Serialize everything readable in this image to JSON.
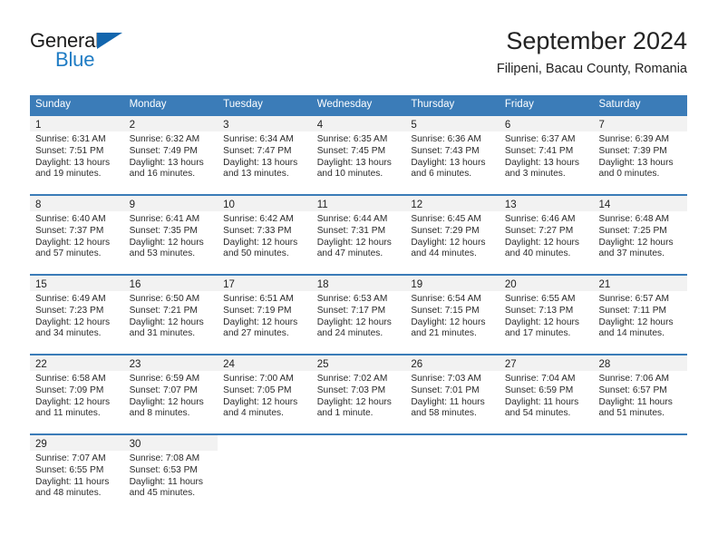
{
  "brand": {
    "name_part1": "General",
    "name_part2": "Blue",
    "color_dark": "#1b1b1b",
    "color_blue": "#1f7cc4"
  },
  "header": {
    "title": "September 2024",
    "subtitle": "Filipeni, Bacau County, Romania"
  },
  "theme": {
    "header_bar": "#3b7cb8",
    "day_band": "#f2f2f2",
    "text": "#222222"
  },
  "weekdays": [
    "Sunday",
    "Monday",
    "Tuesday",
    "Wednesday",
    "Thursday",
    "Friday",
    "Saturday"
  ],
  "weeks": [
    [
      {
        "day": "1",
        "sunrise": "Sunrise: 6:31 AM",
        "sunset": "Sunset: 7:51 PM",
        "daylight1": "Daylight: 13 hours",
        "daylight2": "and 19 minutes."
      },
      {
        "day": "2",
        "sunrise": "Sunrise: 6:32 AM",
        "sunset": "Sunset: 7:49 PM",
        "daylight1": "Daylight: 13 hours",
        "daylight2": "and 16 minutes."
      },
      {
        "day": "3",
        "sunrise": "Sunrise: 6:34 AM",
        "sunset": "Sunset: 7:47 PM",
        "daylight1": "Daylight: 13 hours",
        "daylight2": "and 13 minutes."
      },
      {
        "day": "4",
        "sunrise": "Sunrise: 6:35 AM",
        "sunset": "Sunset: 7:45 PM",
        "daylight1": "Daylight: 13 hours",
        "daylight2": "and 10 minutes."
      },
      {
        "day": "5",
        "sunrise": "Sunrise: 6:36 AM",
        "sunset": "Sunset: 7:43 PM",
        "daylight1": "Daylight: 13 hours",
        "daylight2": "and 6 minutes."
      },
      {
        "day": "6",
        "sunrise": "Sunrise: 6:37 AM",
        "sunset": "Sunset: 7:41 PM",
        "daylight1": "Daylight: 13 hours",
        "daylight2": "and 3 minutes."
      },
      {
        "day": "7",
        "sunrise": "Sunrise: 6:39 AM",
        "sunset": "Sunset: 7:39 PM",
        "daylight1": "Daylight: 13 hours",
        "daylight2": "and 0 minutes."
      }
    ],
    [
      {
        "day": "8",
        "sunrise": "Sunrise: 6:40 AM",
        "sunset": "Sunset: 7:37 PM",
        "daylight1": "Daylight: 12 hours",
        "daylight2": "and 57 minutes."
      },
      {
        "day": "9",
        "sunrise": "Sunrise: 6:41 AM",
        "sunset": "Sunset: 7:35 PM",
        "daylight1": "Daylight: 12 hours",
        "daylight2": "and 53 minutes."
      },
      {
        "day": "10",
        "sunrise": "Sunrise: 6:42 AM",
        "sunset": "Sunset: 7:33 PM",
        "daylight1": "Daylight: 12 hours",
        "daylight2": "and 50 minutes."
      },
      {
        "day": "11",
        "sunrise": "Sunrise: 6:44 AM",
        "sunset": "Sunset: 7:31 PM",
        "daylight1": "Daylight: 12 hours",
        "daylight2": "and 47 minutes."
      },
      {
        "day": "12",
        "sunrise": "Sunrise: 6:45 AM",
        "sunset": "Sunset: 7:29 PM",
        "daylight1": "Daylight: 12 hours",
        "daylight2": "and 44 minutes."
      },
      {
        "day": "13",
        "sunrise": "Sunrise: 6:46 AM",
        "sunset": "Sunset: 7:27 PM",
        "daylight1": "Daylight: 12 hours",
        "daylight2": "and 40 minutes."
      },
      {
        "day": "14",
        "sunrise": "Sunrise: 6:48 AM",
        "sunset": "Sunset: 7:25 PM",
        "daylight1": "Daylight: 12 hours",
        "daylight2": "and 37 minutes."
      }
    ],
    [
      {
        "day": "15",
        "sunrise": "Sunrise: 6:49 AM",
        "sunset": "Sunset: 7:23 PM",
        "daylight1": "Daylight: 12 hours",
        "daylight2": "and 34 minutes."
      },
      {
        "day": "16",
        "sunrise": "Sunrise: 6:50 AM",
        "sunset": "Sunset: 7:21 PM",
        "daylight1": "Daylight: 12 hours",
        "daylight2": "and 31 minutes."
      },
      {
        "day": "17",
        "sunrise": "Sunrise: 6:51 AM",
        "sunset": "Sunset: 7:19 PM",
        "daylight1": "Daylight: 12 hours",
        "daylight2": "and 27 minutes."
      },
      {
        "day": "18",
        "sunrise": "Sunrise: 6:53 AM",
        "sunset": "Sunset: 7:17 PM",
        "daylight1": "Daylight: 12 hours",
        "daylight2": "and 24 minutes."
      },
      {
        "day": "19",
        "sunrise": "Sunrise: 6:54 AM",
        "sunset": "Sunset: 7:15 PM",
        "daylight1": "Daylight: 12 hours",
        "daylight2": "and 21 minutes."
      },
      {
        "day": "20",
        "sunrise": "Sunrise: 6:55 AM",
        "sunset": "Sunset: 7:13 PM",
        "daylight1": "Daylight: 12 hours",
        "daylight2": "and 17 minutes."
      },
      {
        "day": "21",
        "sunrise": "Sunrise: 6:57 AM",
        "sunset": "Sunset: 7:11 PM",
        "daylight1": "Daylight: 12 hours",
        "daylight2": "and 14 minutes."
      }
    ],
    [
      {
        "day": "22",
        "sunrise": "Sunrise: 6:58 AM",
        "sunset": "Sunset: 7:09 PM",
        "daylight1": "Daylight: 12 hours",
        "daylight2": "and 11 minutes."
      },
      {
        "day": "23",
        "sunrise": "Sunrise: 6:59 AM",
        "sunset": "Sunset: 7:07 PM",
        "daylight1": "Daylight: 12 hours",
        "daylight2": "and 8 minutes."
      },
      {
        "day": "24",
        "sunrise": "Sunrise: 7:00 AM",
        "sunset": "Sunset: 7:05 PM",
        "daylight1": "Daylight: 12 hours",
        "daylight2": "and 4 minutes."
      },
      {
        "day": "25",
        "sunrise": "Sunrise: 7:02 AM",
        "sunset": "Sunset: 7:03 PM",
        "daylight1": "Daylight: 12 hours",
        "daylight2": "and 1 minute."
      },
      {
        "day": "26",
        "sunrise": "Sunrise: 7:03 AM",
        "sunset": "Sunset: 7:01 PM",
        "daylight1": "Daylight: 11 hours",
        "daylight2": "and 58 minutes."
      },
      {
        "day": "27",
        "sunrise": "Sunrise: 7:04 AM",
        "sunset": "Sunset: 6:59 PM",
        "daylight1": "Daylight: 11 hours",
        "daylight2": "and 54 minutes."
      },
      {
        "day": "28",
        "sunrise": "Sunrise: 7:06 AM",
        "sunset": "Sunset: 6:57 PM",
        "daylight1": "Daylight: 11 hours",
        "daylight2": "and 51 minutes."
      }
    ],
    [
      {
        "day": "29",
        "sunrise": "Sunrise: 7:07 AM",
        "sunset": "Sunset: 6:55 PM",
        "daylight1": "Daylight: 11 hours",
        "daylight2": "and 48 minutes."
      },
      {
        "day": "30",
        "sunrise": "Sunrise: 7:08 AM",
        "sunset": "Sunset: 6:53 PM",
        "daylight1": "Daylight: 11 hours",
        "daylight2": "and 45 minutes."
      },
      {
        "day": "",
        "sunrise": "",
        "sunset": "",
        "daylight1": "",
        "daylight2": ""
      },
      {
        "day": "",
        "sunrise": "",
        "sunset": "",
        "daylight1": "",
        "daylight2": ""
      },
      {
        "day": "",
        "sunrise": "",
        "sunset": "",
        "daylight1": "",
        "daylight2": ""
      },
      {
        "day": "",
        "sunrise": "",
        "sunset": "",
        "daylight1": "",
        "daylight2": ""
      },
      {
        "day": "",
        "sunrise": "",
        "sunset": "",
        "daylight1": "",
        "daylight2": ""
      }
    ]
  ]
}
